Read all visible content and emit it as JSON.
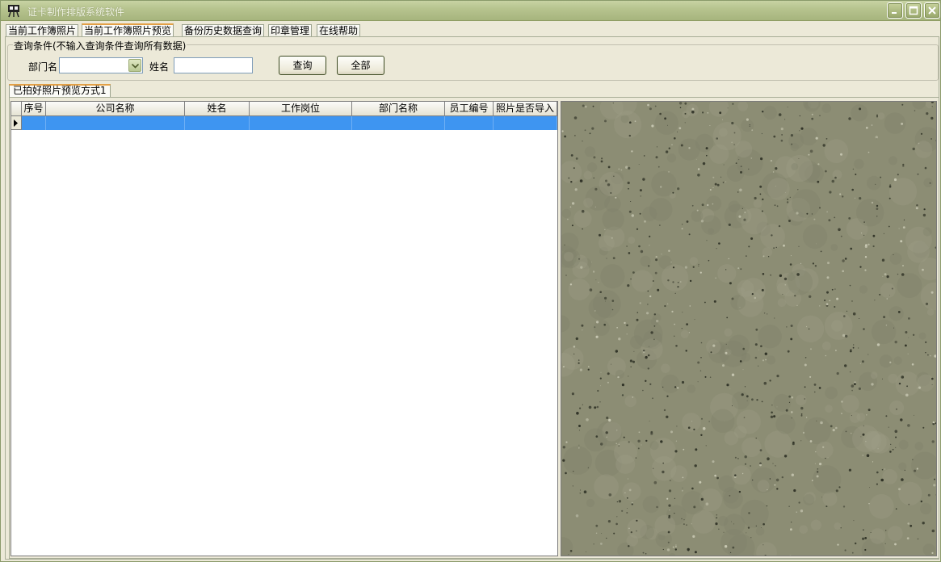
{
  "window": {
    "title": "证卡制作排版系统软件"
  },
  "tabs": [
    {
      "label": "当前工作簿照片"
    },
    {
      "label": "当前工作簿照片预览",
      "active": true
    },
    {
      "label": "备份历史数据查询"
    },
    {
      "label": "印章管理"
    },
    {
      "label": "在线帮助"
    }
  ],
  "query": {
    "legend": "查询条件(不输入查询条件查询所有数据)",
    "dept_label": "部门名",
    "dept_value": "",
    "name_label": "姓名",
    "name_value": "",
    "search_button": "查询",
    "all_button": "全部"
  },
  "subtab": {
    "label": "已拍好照片预览方式1"
  },
  "grid": {
    "columns": [
      "序号",
      "公司名称",
      "姓名",
      "工作岗位",
      "部门名称",
      "员工编号",
      "照片是否导入"
    ],
    "rows": [
      [
        "",
        "",
        "",
        "",
        "",
        "",
        ""
      ]
    ]
  },
  "colors": {
    "selection": "#3e95f1",
    "accent_tab": "#e3a046",
    "titlebar": "#b7c48f",
    "preview_texture": "#8c8d74"
  },
  "icons": {
    "app": "camera-icon",
    "minimize": "minimize-icon",
    "maximize": "maximize-icon",
    "close": "close-icon",
    "combo": "chevron-down-icon",
    "row_indicator": "row-pointer-icon"
  }
}
